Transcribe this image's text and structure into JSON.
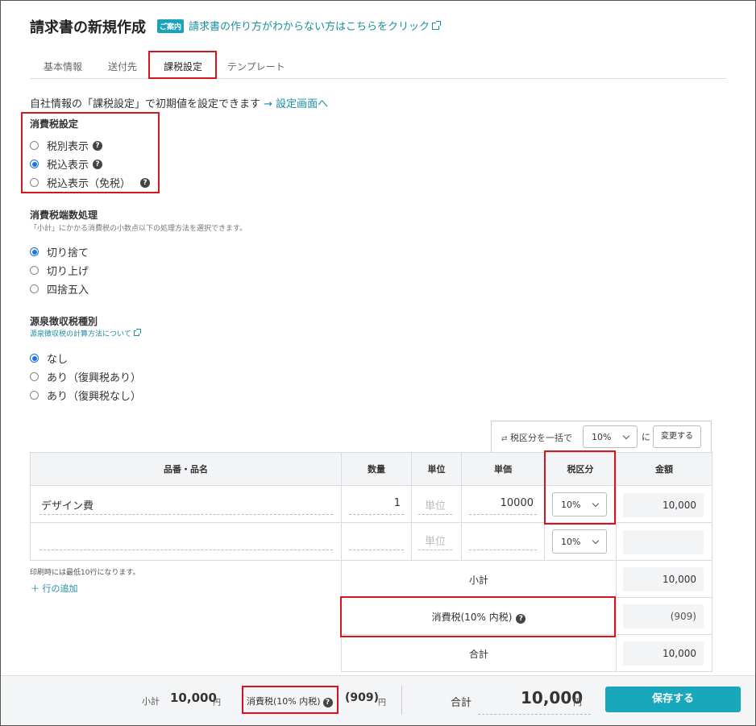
{
  "header": {
    "title": "請求書の新規作成",
    "guide_badge": "ご案内",
    "guide_link": "請求書の作り方がわからない方はこちらをクリック"
  },
  "tabs": [
    {
      "label": "基本情報",
      "active": false
    },
    {
      "label": "送付先",
      "active": false
    },
    {
      "label": "課税設定",
      "active": true
    },
    {
      "label": "テンプレート",
      "active": false
    }
  ],
  "info": {
    "text": "自社情報の「課税設定」で初期値を設定できます",
    "link": "→ 設定画面へ"
  },
  "consumption_tax": {
    "title": "消費税設定",
    "options": [
      {
        "label": "税別表示",
        "checked": false,
        "help": true
      },
      {
        "label": "税込表示",
        "checked": true,
        "help": true
      },
      {
        "label": "税込表示（免税）",
        "checked": false,
        "help": true
      }
    ]
  },
  "rounding": {
    "title": "消費税端数処理",
    "description": "「小計」にかかる消費税の小数点以下の処理方法を選択できます。",
    "options": [
      {
        "label": "切り捨て",
        "checked": true
      },
      {
        "label": "切り上げ",
        "checked": false
      },
      {
        "label": "四捨五入",
        "checked": false
      }
    ]
  },
  "withholding": {
    "title": "源泉徴収税種別",
    "link": "源泉徴収税の計算方法について",
    "options": [
      {
        "label": "なし",
        "checked": true
      },
      {
        "label": "あり（復興税あり）",
        "checked": false
      },
      {
        "label": "あり（復興税なし）",
        "checked": false
      }
    ]
  },
  "bulk": {
    "label": "税区分を一括で",
    "rate": "10%",
    "suffix": "に",
    "button": "変更する"
  },
  "table": {
    "headers": {
      "item": "品番・品名",
      "qty": "数量",
      "unit": "単位",
      "price": "単価",
      "tax": "税区分",
      "amount": "金額"
    },
    "rows": [
      {
        "item": "デザイン費",
        "qty": "1",
        "unit_placeholder": "単位",
        "price": "10000",
        "tax": "10%",
        "amount": "10,000"
      },
      {
        "item": "",
        "qty": "",
        "unit_placeholder": "単位",
        "price": "",
        "tax": "10%",
        "amount": ""
      }
    ],
    "subtotal_label": "小計",
    "subtotal": "10,000",
    "tax_label": "消費税(10% 内税)",
    "tax_value": "(909)",
    "total_label": "合計",
    "total": "10,000"
  },
  "print_note": "印刷時には最低10行になります。",
  "add_row": "＋ 行の追加",
  "footer": {
    "subtotal_label": "小計",
    "subtotal": "10,000",
    "yen": "円",
    "tax_label": "消費税(10% 内税)",
    "tax_value": "(909)",
    "total_label": "合計",
    "total": "10,000",
    "save": "保存する"
  }
}
